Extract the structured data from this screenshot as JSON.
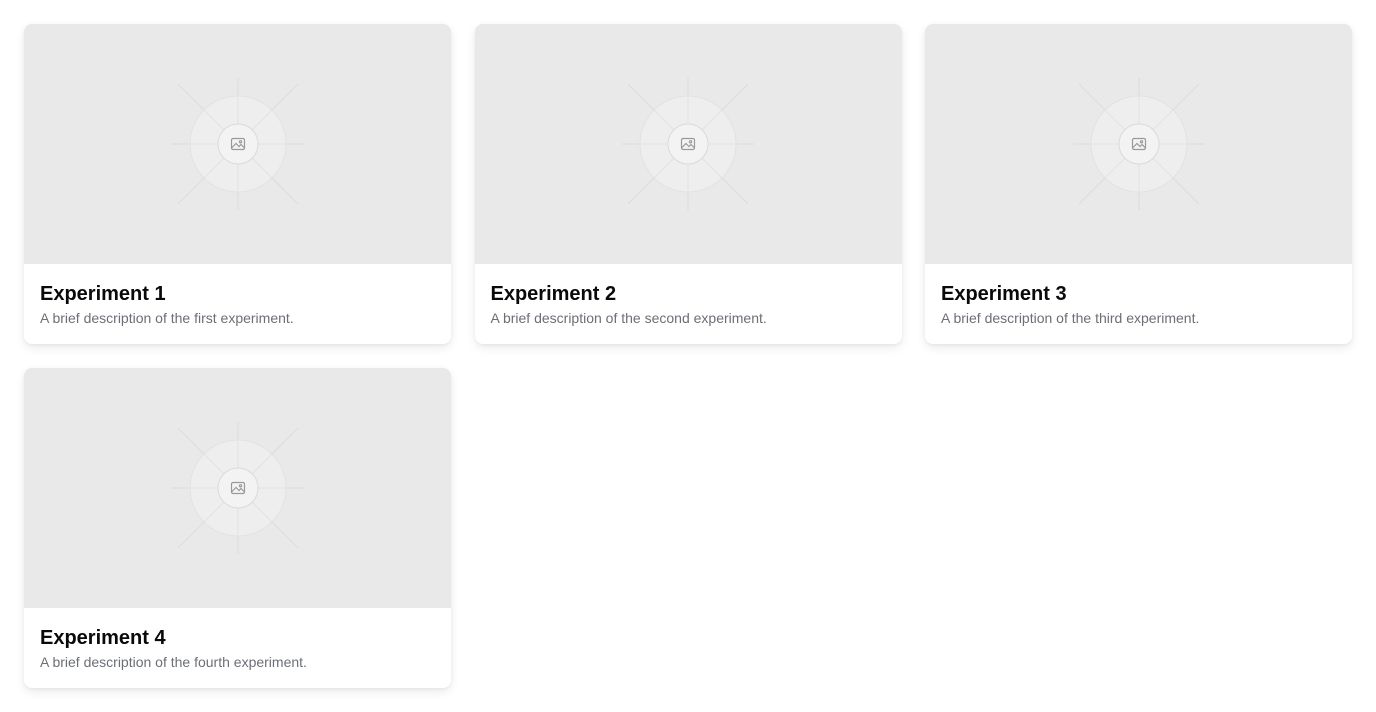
{
  "experiments": [
    {
      "title": "Experiment 1",
      "description": "A brief description of the first experiment.",
      "image_icon": "image-placeholder-icon"
    },
    {
      "title": "Experiment 2",
      "description": "A brief description of the second experiment.",
      "image_icon": "image-placeholder-icon"
    },
    {
      "title": "Experiment 3",
      "description": "A brief description of the third experiment.",
      "image_icon": "image-placeholder-icon"
    },
    {
      "title": "Experiment 4",
      "description": "A brief description of the fourth experiment.",
      "image_icon": "image-placeholder-icon"
    }
  ],
  "colors": {
    "thumbnail_bg": "#e9e9e9",
    "title": "#0a0a0a",
    "description": "#6b6f76"
  }
}
